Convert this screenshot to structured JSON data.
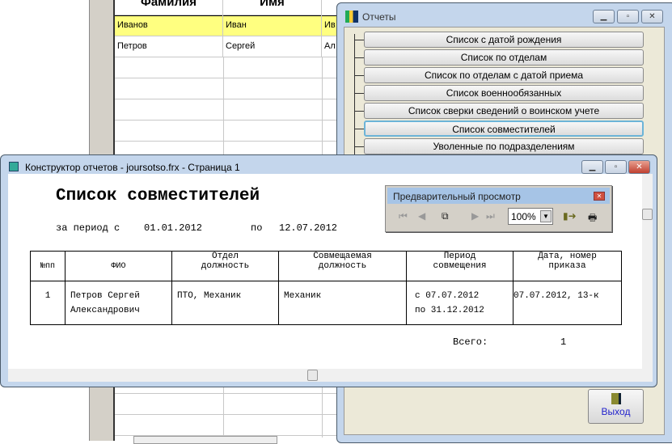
{
  "grid": {
    "headers": [
      "Фамилия",
      "Имя"
    ],
    "rows": [
      [
        "Иванов",
        "Иван",
        "Ив"
      ],
      [
        "Петров",
        "Сергей",
        "Ал"
      ]
    ]
  },
  "reports": {
    "title": "Отчеты",
    "buttons": [
      "Список с датой рождения",
      "Список по отделам",
      "Список по отделам с датой приема",
      "Список военнообязанных",
      "Список сверки сведений о воинском учете",
      "Список совместителей",
      "Уволенные по подразделениям"
    ],
    "exit_label": "Выход"
  },
  "designer": {
    "title": "Конструктор отчетов - joursotso.frx - Страница 1"
  },
  "preview": {
    "title": "Предварительный просмотр",
    "zoom": "100%"
  },
  "report": {
    "title": "Список совместителей",
    "period_from_label": "за период с",
    "period_from": "01.01.2012",
    "period_to_label": "по",
    "period_to": "12.07.2012",
    "headers": [
      "№пп",
      "ФИО",
      "Отдел должность",
      "Совмещаемая должность",
      "Период совмещения",
      "Дата, номер приказа"
    ],
    "row": {
      "num": "1",
      "fio_1": "Петров Сергей",
      "fio_2": "Александрович",
      "dept": "ПТО, Механик",
      "position": "Механик",
      "period_1": "с 07.07.2012",
      "period_2": "по 31.12.2012",
      "order": "07.07.2012, 13-к"
    },
    "total_label": "Всего:",
    "total": "1"
  }
}
